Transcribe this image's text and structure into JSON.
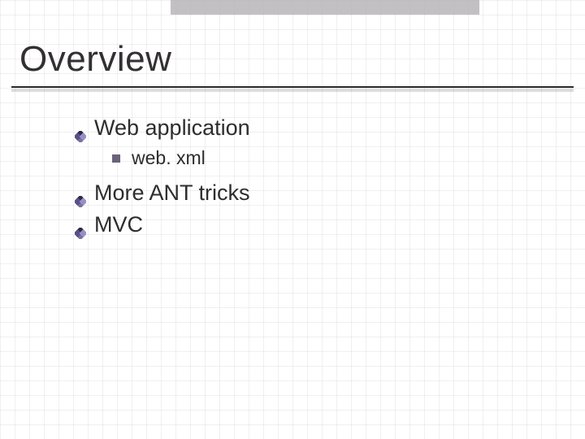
{
  "slide": {
    "title": "Overview",
    "items": [
      {
        "label": "Web application",
        "children": [
          {
            "label": "web. xml"
          }
        ]
      },
      {
        "label": "More ANT tricks"
      },
      {
        "label": "MVC"
      }
    ]
  }
}
